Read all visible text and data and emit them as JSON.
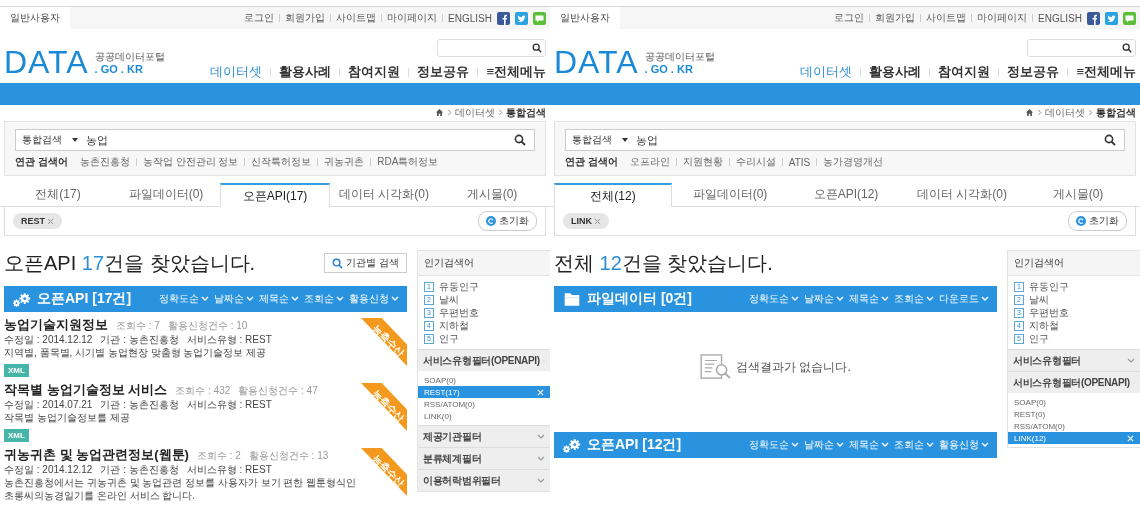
{
  "panels": [
    {
      "top_bar": {
        "user_tab": "일반사용자",
        "links": [
          "로그인",
          "회원가입",
          "사이트맵",
          "마이페이지",
          "ENGLISH"
        ]
      },
      "logo": {
        "mark": "DATA",
        "name": "공공데이터포털",
        "domain": ". GO . KR"
      },
      "nav": [
        {
          "label": "데이터셋",
          "selected": true
        },
        {
          "label": "활용사례",
          "selected": false
        },
        {
          "label": "참여지원",
          "selected": false
        },
        {
          "label": "정보공유",
          "selected": false
        },
        {
          "label": "≡전체메뉴",
          "selected": false
        }
      ],
      "breadcrumb": [
        "데이터셋",
        "통합검색"
      ],
      "search": {
        "scope": "통합검색",
        "value": "농업"
      },
      "related": {
        "label": "연관 검색어",
        "terms": [
          "농촌진흥청",
          "농작업 안전관리 정보",
          "신작특허정보",
          "귀농귀촌",
          "RDA특허정보"
        ]
      },
      "tabs": [
        {
          "label": "전체(17)",
          "selected": false
        },
        {
          "label": "파일데이터(0)",
          "selected": false
        },
        {
          "label": "오픈API(17)",
          "selected": true
        },
        {
          "label": "데이터 시각화(0)",
          "selected": false
        },
        {
          "label": "게시물(0)",
          "selected": false
        }
      ],
      "chips": [
        "REST"
      ],
      "reset_button": "초기화",
      "heading": {
        "prefix": "오픈API ",
        "count": "17",
        "suffix": "건을 찾았습니다."
      },
      "agency_button": "기관별 검색",
      "sections": [
        {
          "kind": "openapi",
          "title": "오픈API [17건]",
          "sorts": [
            "정확도순",
            "날짜순",
            "제목순",
            "조회순",
            "활용신청"
          ],
          "items": [
            {
              "title": "농업기술지원정보",
              "views": "조회수 : 7",
              "requests": "활용신청건수 : 10",
              "modified": "수정일 : 2014.12.12",
              "agency": "기관 : 농촌진흥청",
              "service_type": "서비스유형 : REST",
              "description": "지역별, 품목별, 시기별 농업현장 맞춤형 농업기술정보 제공",
              "format": "XML",
              "ribbon": "농축수산"
            },
            {
              "title": "작목별 농업기술정보 서비스",
              "views": "조회수 : 432",
              "requests": "활용신청건수 : 47",
              "modified": "수정일 : 2014.07.21",
              "agency": "기관 : 농촌진흥청",
              "service_type": "서비스유형 : REST",
              "description": "작목별 농업기술정보를 제공",
              "format": "XML",
              "ribbon": "농축수산"
            },
            {
              "title": "귀농귀촌 및 농업관련정보(웹툰)",
              "views": "조회수 : 2",
              "requests": "활용신청건수 : 13",
              "modified": "수정일 : 2014.12.12",
              "agency": "기관 : 농촌진흥청",
              "service_type": "서비스유형 : REST",
              "description": "농촌진흥청에서는 귀농귀촌 및 농업관련 정보를 사용자가 보기 편한 웹툰형식인 초롱씨의농경일기를 온라인 서비스 합니다.",
              "ribbon": "농축수산"
            }
          ]
        }
      ],
      "sidebar": {
        "title": "인기검색어",
        "popular": [
          {
            "rank": "1",
            "term": "유동인구"
          },
          {
            "rank": "2",
            "term": "날씨"
          },
          {
            "rank": "3",
            "term": "우편번호"
          },
          {
            "rank": "4",
            "term": "지하철"
          },
          {
            "rank": "5",
            "term": "인구"
          }
        ],
        "filters": [
          {
            "title": "서비스유형필터(OPENAPI)",
            "expanded": true,
            "options": [
              {
                "label": "SOAP(0)",
                "selected": false
              },
              {
                "label": "REST(17)",
                "selected": true
              },
              {
                "label": "RSS/ATOM(0)",
                "selected": false
              },
              {
                "label": "LINK(0)",
                "selected": false
              }
            ]
          },
          {
            "title": "제공기관필터",
            "expanded": false
          },
          {
            "title": "분류체계필터",
            "expanded": false
          },
          {
            "title": "이용허락범위필터",
            "expanded": false
          }
        ]
      }
    },
    {
      "top_bar": {
        "user_tab": "일반사용자",
        "links": [
          "로그인",
          "회원가입",
          "사이트맵",
          "마이페이지",
          "ENGLISH"
        ]
      },
      "logo": {
        "mark": "DATA",
        "name": "공공데이터포털",
        "domain": ". GO . KR"
      },
      "nav": [
        {
          "label": "데이터셋",
          "selected": true
        },
        {
          "label": "활용사례",
          "selected": false
        },
        {
          "label": "참여지원",
          "selected": false
        },
        {
          "label": "정보공유",
          "selected": false
        },
        {
          "label": "≡전체메뉴",
          "selected": false
        }
      ],
      "breadcrumb": [
        "데이터셋",
        "통합검색"
      ],
      "search": {
        "scope": "통합검색",
        "value": "농업"
      },
      "related": {
        "label": "연관 검색어",
        "terms": [
          "오프라인",
          "지원현황",
          "수리시설",
          "ATIS",
          "농가경영개선"
        ]
      },
      "tabs": [
        {
          "label": "전체(12)",
          "selected": true
        },
        {
          "label": "파일데이터(0)",
          "selected": false
        },
        {
          "label": "오픈API(12)",
          "selected": false
        },
        {
          "label": "데이터 시각화(0)",
          "selected": false
        },
        {
          "label": "게시물(0)",
          "selected": false
        }
      ],
      "chips": [
        "LINK"
      ],
      "reset_button": "초기화",
      "heading": {
        "prefix": "전체 ",
        "count": "12",
        "suffix": "건을 찾았습니다."
      },
      "sections": [
        {
          "kind": "file",
          "title": "파일데이터 [0건]",
          "sorts": [
            "정확도순",
            "날짜순",
            "제목순",
            "조회순",
            "다운로드"
          ],
          "empty_message": "검색결과가 없습니다."
        },
        {
          "kind": "openapi",
          "title": "오픈API [12건]",
          "sorts": [
            "정확도순",
            "날짜순",
            "제목순",
            "조회순",
            "활용신청"
          ]
        }
      ],
      "sidebar": {
        "title": "인기검색어",
        "popular": [
          {
            "rank": "1",
            "term": "유동인구"
          },
          {
            "rank": "2",
            "term": "날씨"
          },
          {
            "rank": "3",
            "term": "우편번호"
          },
          {
            "rank": "4",
            "term": "지하철"
          },
          {
            "rank": "5",
            "term": "인구"
          }
        ],
        "filters": [
          {
            "title": "서비스유형필터",
            "expanded": false
          },
          {
            "title": "서비스유형필터(OPENAPI)",
            "expanded": true,
            "options": [
              {
                "label": "SOAP(0)",
                "selected": false
              },
              {
                "label": "REST(0)",
                "selected": false
              },
              {
                "label": "RSS/ATOM(0)",
                "selected": false
              },
              {
                "label": "LINK(12)",
                "selected": true
              }
            ]
          }
        ]
      }
    }
  ]
}
